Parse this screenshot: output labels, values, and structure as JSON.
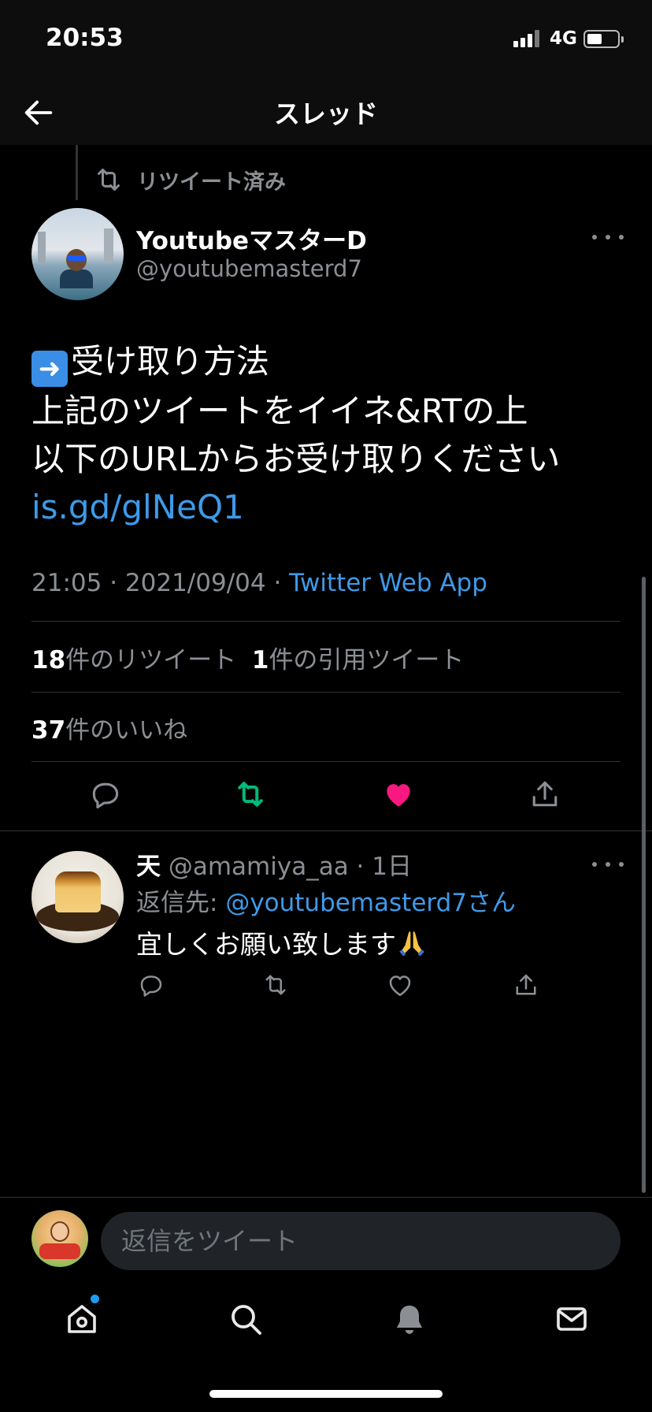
{
  "status_bar": {
    "time": "20:53",
    "network": "4G"
  },
  "header": {
    "title": "スレッド"
  },
  "retweet_context": {
    "label": "リツイート済み"
  },
  "tweet": {
    "display_name": "YoutubeマスターD",
    "handle": "@youtubemasterd7",
    "body_lines": [
      "受け取り方法",
      "上記のツイートをイイネ&RTの上",
      "以下のURLからお受け取りください"
    ],
    "link": "is.gd/glNeQ1",
    "time": "21:05",
    "date": "2021/09/04",
    "source": "Twitter Web App",
    "retweet_count": "18",
    "retweet_label": "件のリツイート",
    "quote_count": "1",
    "quote_label": "件の引用ツイート",
    "like_count": "37",
    "like_label": "件のいいね",
    "liked": true,
    "retweeted": true
  },
  "reply": {
    "display_name": "天",
    "handle": "@amamiya_aa",
    "age": "1日",
    "reply_to_prefix": "返信先:",
    "reply_to_mention": "@youtubemasterd7さん",
    "text": "宜しくお願い致します"
  },
  "composer": {
    "placeholder": "返信をツイート"
  },
  "tab_bar": {
    "items": [
      "home-icon",
      "search-icon",
      "bell-icon",
      "mail-icon"
    ]
  },
  "colors": {
    "accent": "#1d9bf0",
    "link": "#3e9ae8",
    "retweet_green": "#00ba7c",
    "like_red": "#f91880",
    "muted": "#8b8f94"
  }
}
